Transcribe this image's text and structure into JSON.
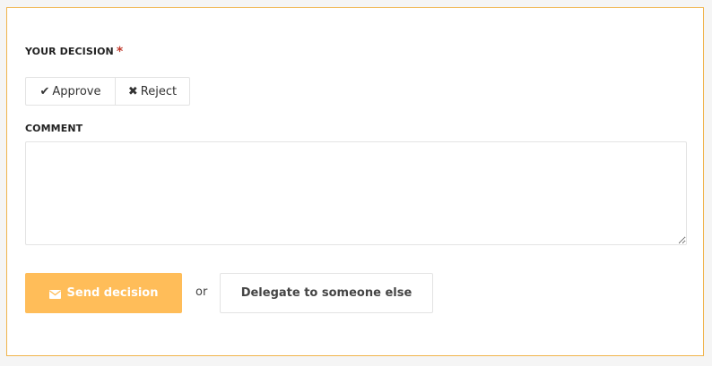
{
  "decision": {
    "label": "YOUR DECISION",
    "required_marker": "*",
    "approve_label": "Approve",
    "approve_icon": "check-icon",
    "reject_label": "Reject",
    "reject_icon": "x-icon"
  },
  "comment": {
    "label": "COMMENT",
    "value": "",
    "placeholder": ""
  },
  "actions": {
    "send_label": "Send decision",
    "send_icon": "envelope-icon",
    "separator": "or",
    "delegate_label": "Delegate to someone else"
  },
  "colors": {
    "accent": "#ffbd59",
    "panel_border": "#f0b44c",
    "required": "#c0392b"
  }
}
